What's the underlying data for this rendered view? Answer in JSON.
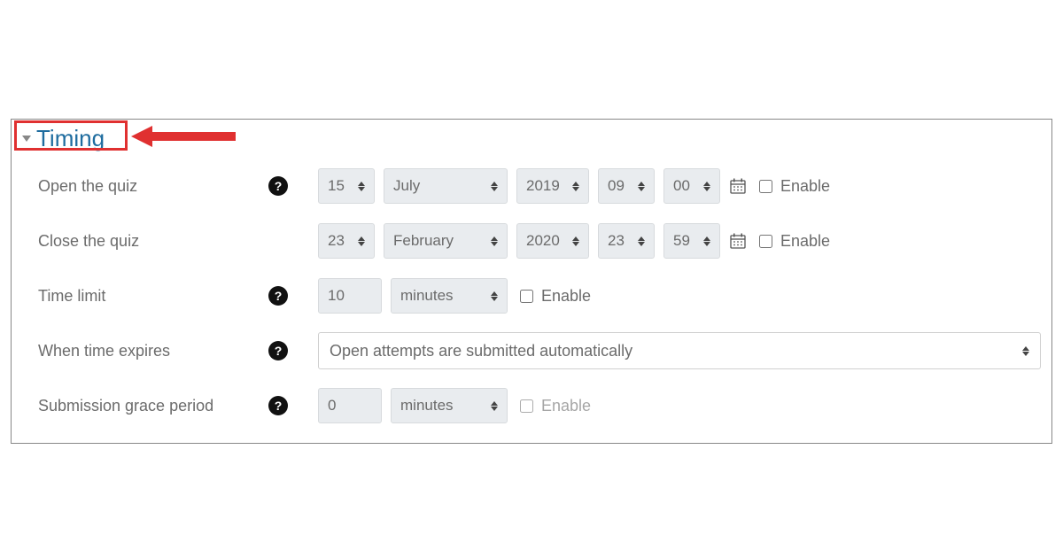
{
  "section": {
    "title": "Timing"
  },
  "labels": {
    "open": "Open the quiz",
    "close": "Close the quiz",
    "timelimit": "Time limit",
    "expires": "When time expires",
    "grace": "Submission grace period",
    "enable": "Enable"
  },
  "open": {
    "day": "15",
    "month": "July",
    "year": "2019",
    "hour": "09",
    "minute": "00"
  },
  "close": {
    "day": "23",
    "month": "February",
    "year": "2020",
    "hour": "23",
    "minute": "59"
  },
  "timelimit": {
    "value": "10",
    "unit": "minutes"
  },
  "expires": {
    "value": "Open attempts are submitted automatically"
  },
  "grace": {
    "value": "0",
    "unit": "minutes"
  },
  "help_glyph": "?"
}
